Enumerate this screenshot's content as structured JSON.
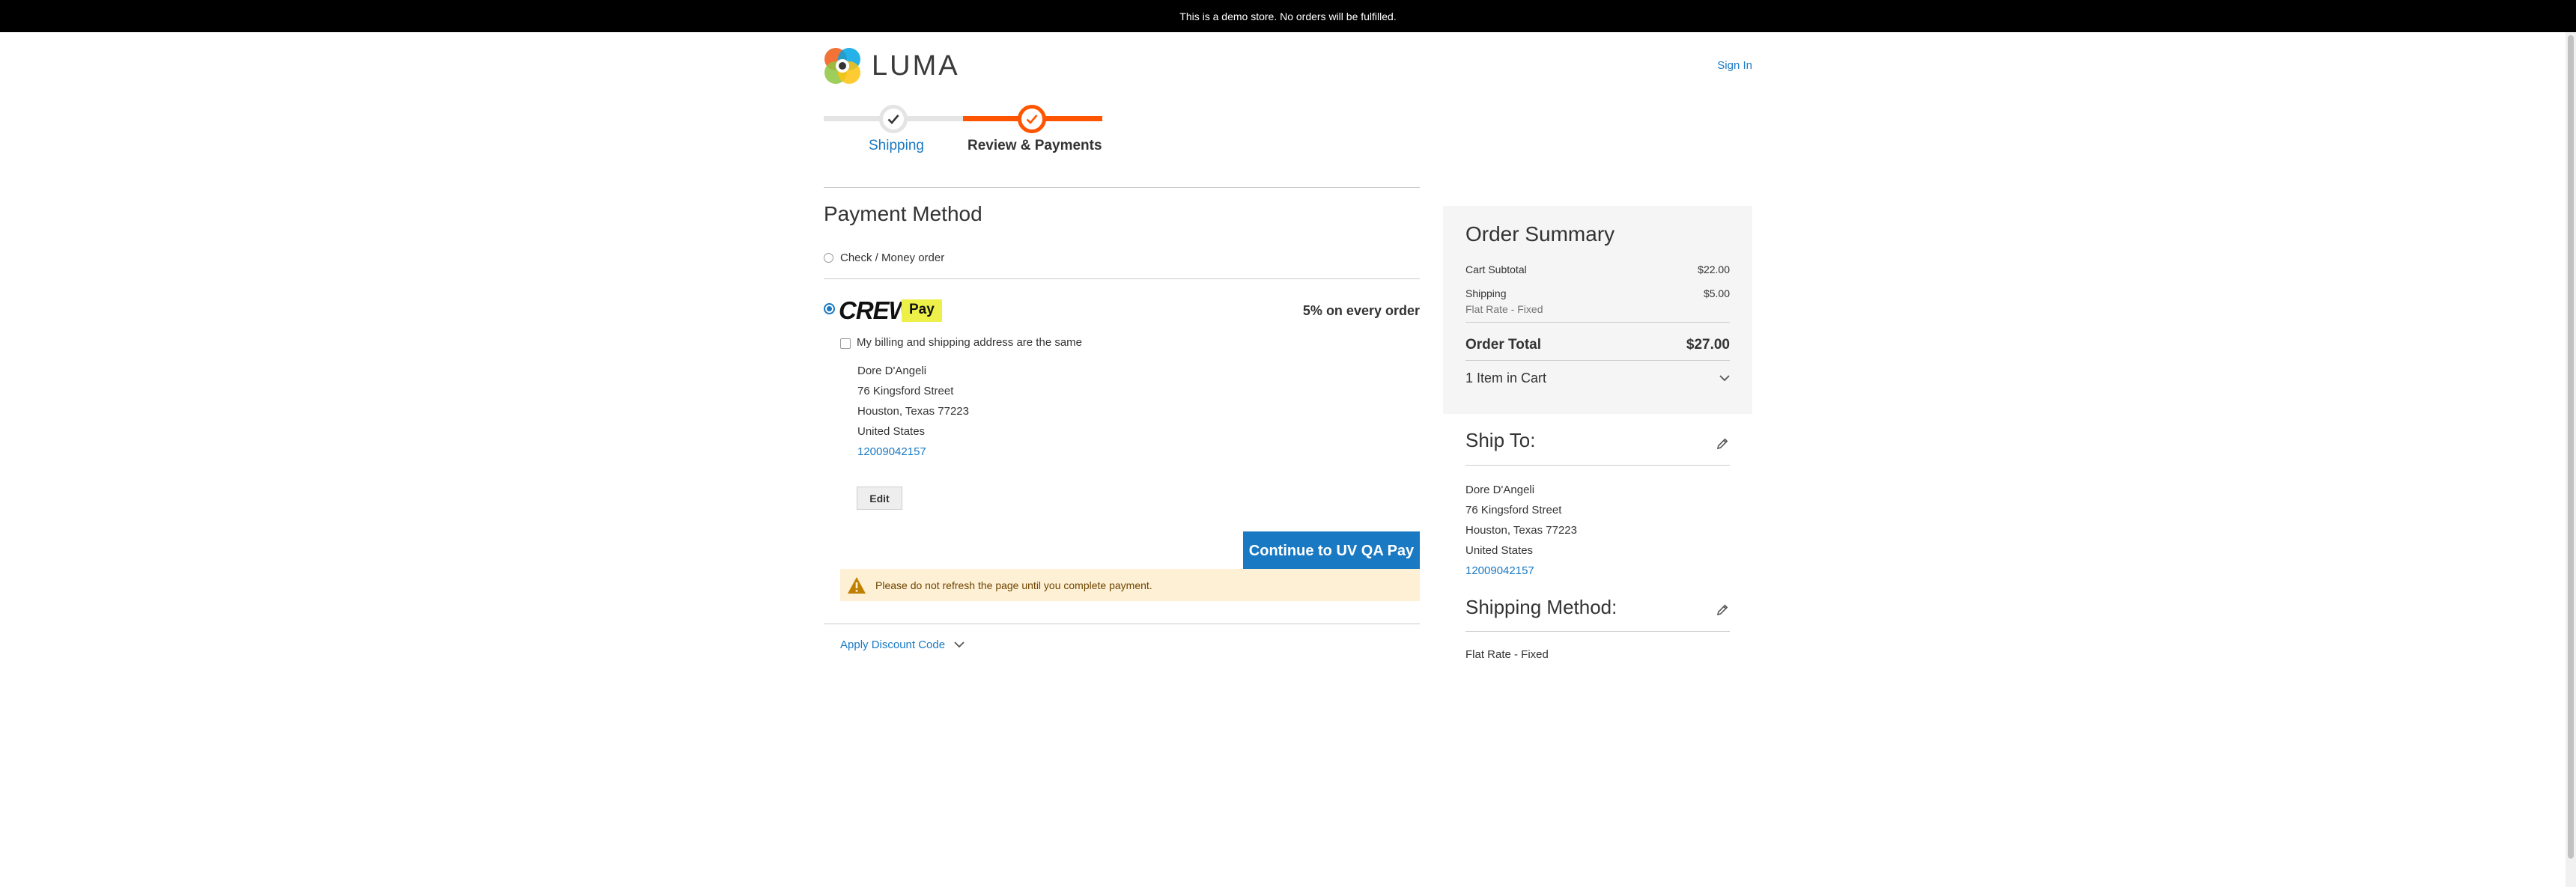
{
  "demo_notice": "This is a demo store. No orders will be fulfilled.",
  "header": {
    "logo_text": "LUMA",
    "sign_in": "Sign In"
  },
  "progress": {
    "steps": [
      {
        "label": "Shipping",
        "state": "complete"
      },
      {
        "label": "Review & Payments",
        "state": "active"
      }
    ]
  },
  "payment": {
    "title": "Payment Method",
    "methods": [
      {
        "label": "Check / Money order",
        "selected": false
      },
      {
        "brand": "CREW",
        "badge": "Pay",
        "promo": "5% on every order",
        "selected": true
      }
    ],
    "billing_same_label": "My billing and shipping address are the same",
    "billing_same_checked": false,
    "billing_address": {
      "name": "Dore D'Angeli",
      "street": "76 Kingsford Street",
      "city_line": "Houston, Texas 77223",
      "country": "United States",
      "phone": "12009042157"
    },
    "edit_label": "Edit",
    "continue_label": "Continue to UV QA Pay",
    "warning_text": "Please do not refresh the page until you complete payment.",
    "discount_label": "Apply Discount Code"
  },
  "summary": {
    "title": "Order Summary",
    "subtotal_label": "Cart Subtotal",
    "subtotal_value": "$22.00",
    "shipping_label": "Shipping",
    "shipping_value": "$5.00",
    "shipping_method": "Flat Rate - Fixed",
    "total_label": "Order Total",
    "total_value": "$27.00",
    "items_label": "1 Item in Cart"
  },
  "ship_to": {
    "title": "Ship To:",
    "name": "Dore D'Angeli",
    "street": "76 Kingsford Street",
    "city_line": "Houston, Texas 77223",
    "country": "United States",
    "phone": "12009042157"
  },
  "shipping_method": {
    "title": "Shipping Method:",
    "value": "Flat Rate - Fixed"
  },
  "colors": {
    "accent": "#1979c3",
    "progress": "#ff5501",
    "warning_bg": "#fdf0d5",
    "pay_badge": "#eef04a"
  },
  "icons": {
    "logo": "luma-logo-icon",
    "check": "checkmark-icon",
    "warning": "warning-triangle-icon",
    "chevron": "chevron-down-icon",
    "edit": "pencil-icon"
  }
}
